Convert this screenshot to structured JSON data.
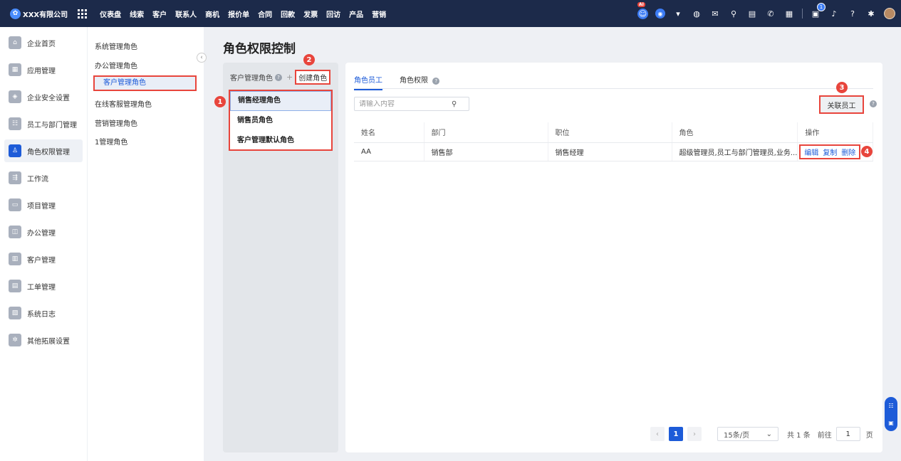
{
  "topbar": {
    "company": "XXX有限公司",
    "nav": [
      "仪表盘",
      "线索",
      "客户",
      "联系人",
      "商机",
      "报价单",
      "合同",
      "回款",
      "发票",
      "回访",
      "产品",
      "营销"
    ],
    "ai_label": "AI",
    "notification_count": "1"
  },
  "sidebar": {
    "items": [
      {
        "label": "企业首页",
        "icon": "home-icon"
      },
      {
        "label": "应用管理",
        "icon": "apps-icon"
      },
      {
        "label": "企业安全设置",
        "icon": "shield-icon"
      },
      {
        "label": "员工与部门管理",
        "icon": "people-icon"
      },
      {
        "label": "角色权限管理",
        "icon": "user-role-icon"
      },
      {
        "label": "工作流",
        "icon": "workflow-icon"
      },
      {
        "label": "项目管理",
        "icon": "folder-icon"
      },
      {
        "label": "办公管理",
        "icon": "briefcase-icon"
      },
      {
        "label": "客户管理",
        "icon": "contacts-icon"
      },
      {
        "label": "工单管理",
        "icon": "ticket-icon"
      },
      {
        "label": "系统日志",
        "icon": "log-icon"
      },
      {
        "label": "其他拓展设置",
        "icon": "gear-icon"
      }
    ]
  },
  "subsidebar": {
    "items": [
      "系统管理角色",
      "办公管理角色",
      "客户管理角色",
      "在线客服管理角色",
      "营销管理角色",
      "1管理角色"
    ]
  },
  "page": {
    "title": "角色权限控制"
  },
  "role_panel": {
    "heading": "客户管理角色",
    "create_label": "创建角色",
    "roles": [
      "销售经理角色",
      "销售员角色",
      "客户管理默认角色"
    ]
  },
  "content": {
    "tabs": [
      "角色员工",
      "角色权限"
    ],
    "search_placeholder": "请输入内容",
    "link_button": "关联员工",
    "columns": [
      "姓名",
      "部门",
      "职位",
      "角色",
      "操作"
    ],
    "rows": [
      {
        "name": "AA",
        "dept": "销售部",
        "position": "销售经理",
        "roles": "超级管理员,员工与部门管理员,业务...",
        "ops": [
          "编辑",
          "复制",
          "删除"
        ]
      }
    ]
  },
  "pager": {
    "current": "1",
    "page_size": "15条/页",
    "total": "共 1 条",
    "goto_label": "前往",
    "goto_value": "1",
    "page_unit": "页"
  },
  "markers": [
    "1",
    "2",
    "3",
    "4"
  ],
  "colors": {
    "topbar": "#1c2a4a",
    "accent": "#1d5bd8",
    "highlight": "#e8453c"
  }
}
